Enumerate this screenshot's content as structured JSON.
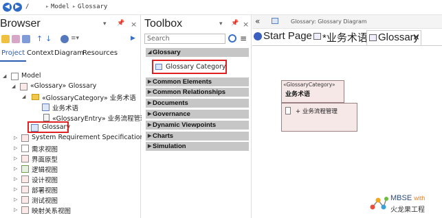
{
  "navbar": {
    "back_icon": "back-arrow-icon",
    "forward_icon": "forward-arrow-icon",
    "path": [
      "/",
      "Model",
      "Glossary"
    ]
  },
  "browser": {
    "title": "Browser",
    "tabs": [
      "Project",
      "Context",
      "Diagram",
      "Resources"
    ],
    "active_tab": "Project",
    "tree": [
      {
        "label": "Model",
        "icon": "model-package-icon",
        "expanded": true
      },
      {
        "label": "«Glossary» Glossary",
        "icon": "glossary-package-icon",
        "expanded": true
      },
      {
        "label": "«GlossaryCategory» 业务术语",
        "icon": "folder-icon",
        "expanded": true
      },
      {
        "label": "业务术语",
        "icon": "diagram-icon"
      },
      {
        "label": "«GlossaryEntry» 业务流程管理",
        "icon": "entry-icon"
      },
      {
        "label": "Glossary",
        "icon": "diagram-icon",
        "selected": true
      },
      {
        "label": "System Requirement Specification",
        "icon": "package-icon",
        "expanded": false
      },
      {
        "label": "需求视图",
        "icon": "package-icon",
        "expanded": false
      },
      {
        "label": "界面原型",
        "icon": "package-icon",
        "expanded": false
      },
      {
        "label": "逻辑视图",
        "icon": "package-icon",
        "expanded": false
      },
      {
        "label": "设计视图",
        "icon": "package-icon",
        "expanded": false
      },
      {
        "label": "部署视图",
        "icon": "package-icon",
        "expanded": false
      },
      {
        "label": "测试视图",
        "icon": "package-icon",
        "expanded": false
      },
      {
        "label": "映射关系视图",
        "icon": "package-icon",
        "expanded": false
      }
    ]
  },
  "toolbox": {
    "title": "Toolbox",
    "search_placeholder": "Search",
    "sections": [
      {
        "label": "Glossary",
        "expanded": true,
        "items": [
          "Glossary Category"
        ]
      },
      {
        "label": "Common Elements",
        "expanded": false
      },
      {
        "label": "Common Relationships",
        "expanded": false
      },
      {
        "label": "Documents",
        "expanded": false
      },
      {
        "label": "Governance",
        "expanded": false
      },
      {
        "label": "Dynamic Viewpoints",
        "expanded": false
      },
      {
        "label": "Charts",
        "expanded": false
      },
      {
        "label": "Simulation",
        "expanded": false
      }
    ]
  },
  "editor": {
    "diagram_caption": "Glossary:  Glossary Diagram",
    "tabs": [
      "Start Page",
      "*业务术语",
      "Glossary"
    ],
    "active_tab": "Glossary",
    "element": {
      "stereotype": "«GlossaryCategory»",
      "name": "业务术语",
      "entry": "+ 业务流程管理"
    }
  },
  "watermark": {
    "line1": "MBSE",
    "line1_suffix": "with",
    "line2": "火龙果工程"
  },
  "colors": {
    "selection_outline": "#e02020",
    "toolbox_section": "#c6c6c6",
    "element_fill": "#f7e8e8",
    "nav_blue": "#2e6bc6"
  }
}
